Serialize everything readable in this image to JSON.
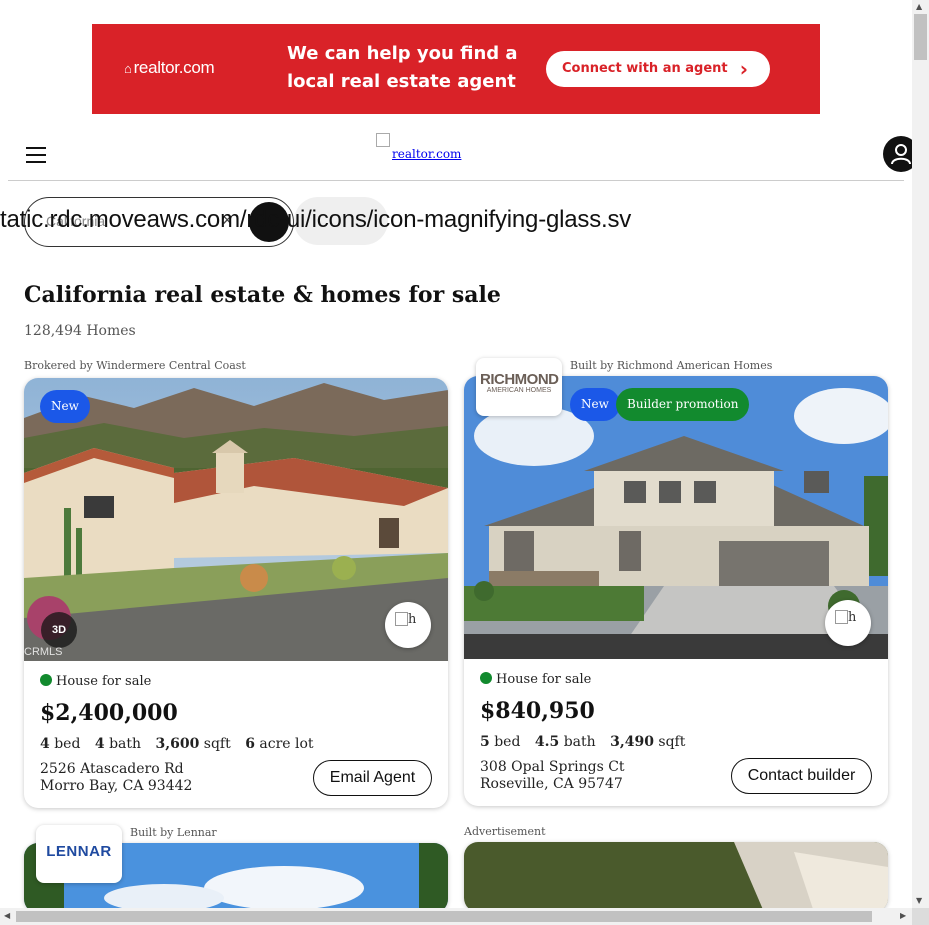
{
  "ad": {
    "logo": "realtor.com",
    "headline": "We can help you find a local real estate agent",
    "cta": "Connect with an agent",
    "color": "#d92228"
  },
  "header": {
    "logo_alt": "realtor.com",
    "menu_icon": "hamburger-menu-icon",
    "account_icon": "user-account-icon"
  },
  "search": {
    "placeholder": "California",
    "clear": "×",
    "overflow_text": "tatic.rdc.moveaws.com/rdc-ui/icons/icon-magnifying-glass.sv"
  },
  "page": {
    "title": "California real estate & homes for sale",
    "count": "128,494 Homes"
  },
  "listings": [
    {
      "brokered_by": "Brokered by Windermere Central Coast",
      "badges": [
        "New"
      ],
      "watermark": "CRMLS",
      "tour_label": "3D",
      "save_alt": "h",
      "status": "House for sale",
      "price": "$2,400,000",
      "beds": "4",
      "beds_label": "bed",
      "baths": "4",
      "baths_label": "bath",
      "sqft": "3,600",
      "sqft_label": "sqft",
      "lot": "6",
      "lot_label": "acre lot",
      "address_line1": "2526 Atascadero Rd",
      "address_line2": "Morro Bay, CA 93442",
      "action": "Email Agent"
    },
    {
      "brokered_by": "Built by Richmond American Homes",
      "builder_logo_line1": "RICHMOND",
      "builder_logo_line2": "AMERICAN HOMES",
      "badges": [
        "New",
        "Builder promotion"
      ],
      "save_alt": "h",
      "status": "House for sale",
      "price": "$840,950",
      "beds": "5",
      "beds_label": "bed",
      "baths": "4.5",
      "baths_label": "bath",
      "sqft": "3,490",
      "sqft_label": "sqft",
      "address_line1": "308 Opal Springs Ct",
      "address_line2": "Roseville, CA 95747",
      "action": "Contact builder"
    },
    {
      "brokered_by": "Built by Lennar",
      "builder_logo": "LENNAR"
    },
    {
      "brokered_by": "Advertisement"
    }
  ],
  "colors": {
    "new_badge": "#1b58e8",
    "promo_badge": "#128a2e",
    "status_dot": "#128a2e",
    "brand_red": "#d92228"
  }
}
